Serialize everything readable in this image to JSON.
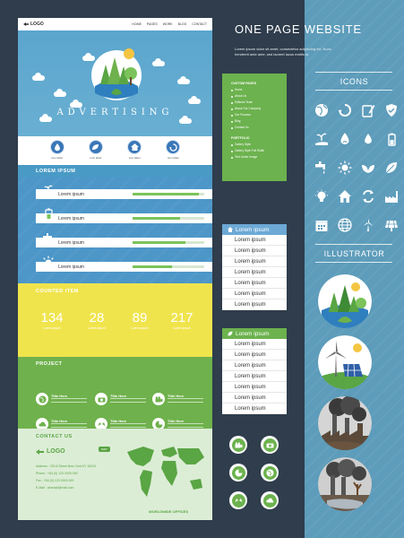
{
  "heading": "ONE PAGE WEBSITE",
  "description": [
    "Lorem ipsum dolor sit amet, consectetur adipiscing elit. Nunc",
    "hendrerit ante ante, sed laoreet lacus mattis et."
  ],
  "nav": {
    "logo": "LOGO",
    "links": [
      "HOME",
      "PAGES",
      "WORK",
      "BLOG",
      "CONTACT"
    ]
  },
  "hero": {
    "title": "ADVERTISING"
  },
  "features": [
    {
      "icon": "water-drop-icon",
      "label": "icon label"
    },
    {
      "icon": "leaf-icon",
      "label": "icon label"
    },
    {
      "icon": "house-icon",
      "label": "icon label"
    },
    {
      "icon": "recycle-icon",
      "label": "icon label"
    }
  ],
  "skills": {
    "title": "LOREM IPSUM",
    "items": [
      {
        "icon": "hand-plant-icon",
        "label": "Lorem ipsum",
        "level": 0.92
      },
      {
        "icon": "battery-icon",
        "label": "Lorem ipsum",
        "level": 0.66
      },
      {
        "icon": "faucet-icon",
        "label": "Lorem ipsum",
        "level": 0.74
      },
      {
        "icon": "sun-icon",
        "label": "Lorem ipsum",
        "level": 0.55
      }
    ]
  },
  "counted": {
    "title": "COUNTED ITEM",
    "items": [
      {
        "value": "134",
        "label": "Lorem ipsum"
      },
      {
        "value": "28",
        "label": "Lorem ipsum"
      },
      {
        "value": "89",
        "label": "Lorem ipsum"
      },
      {
        "value": "217",
        "label": "Lorem ipsum"
      }
    ]
  },
  "project": {
    "title": "PROJECT",
    "items": [
      {
        "icon": "globe-icon",
        "title": "Title Here"
      },
      {
        "icon": "camera-icon",
        "title": "Title Here"
      },
      {
        "icon": "film-camera-icon",
        "title": "Title Here"
      },
      {
        "icon": "cloud-icon",
        "title": "Title Here"
      },
      {
        "icon": "hands-icon",
        "title": "Title Here"
      },
      {
        "icon": "pie-chart-icon",
        "title": "Title Here"
      }
    ]
  },
  "contact": {
    "title": "CONTACT US",
    "logo": "LOGO",
    "address": "Address :  220 A Street New York NY 10010",
    "phone": "Phone  :  +84 (0) 123 0000 000",
    "fax": "Fax   :  +84 (0) 123 0000 000",
    "email": "E-Mail  :  abcmail@mail.com",
    "map_badge": "MAP",
    "map_caption": "WORLDWIDE OFFICES"
  },
  "custom_menu": {
    "heading": "CUSTOM PAGES",
    "items": [
      "Home",
      "About Us",
      "Editorial Team",
      "About Our Company",
      "Our Process",
      "Blog",
      "Contact Us"
    ],
    "heading2": "PORTFOLIO",
    "items2": [
      "Gallery Style",
      "Gallery Style Full Width",
      "Text Under Image"
    ]
  },
  "list1": {
    "head": "Lorem ipsum",
    "items": [
      "Lorem ipsum",
      "Lorem ipsum",
      "Lorem ipsum",
      "Lorem ipsum",
      "Lorem ipsum",
      "Lorem ipsum",
      "Lorem ipsum"
    ]
  },
  "list2": {
    "head": "Lorem ipsum",
    "items": [
      "Lorem ipsum",
      "Lorem ipsum",
      "Lorem ipsum",
      "Lorem ipsum",
      "Lorem ipsum",
      "Lorem ipsum",
      "Lorem ipsum"
    ]
  },
  "round_icons": [
    "film-camera-icon",
    "camera-icon",
    "pie-chart-icon",
    "globe-icon",
    "hands-icon",
    "cloud-icon"
  ],
  "icons_panel": {
    "title": "ICONS",
    "icons": [
      "globe-icon",
      "recycle-icon",
      "pencil-icon",
      "shield-icon",
      "hand-plant-icon",
      "water-drop-icon",
      "oil-drop-icon",
      "battery-icon",
      "faucet-icon",
      "sun-icon",
      "leaves-icon",
      "leaf-icon",
      "lightbulb-icon",
      "house-icon",
      "recycle-arrows-icon",
      "factory-icon",
      "calendar-icon",
      "world-icon",
      "wind-turbine-icon",
      "solar-panel-icon"
    ]
  },
  "illustrator": {
    "title": "ILLUSTRATOR",
    "items": [
      "green-landscape-illustration",
      "wind-solar-illustration",
      "factory-pollution-illustration",
      "dead-trees-factory-illustration"
    ]
  },
  "colors": {
    "background": "#2f3d4c",
    "panel": "#5d9cba",
    "blue": "#4c96c8",
    "green": "#6cb24e",
    "yellow": "#f0e44d"
  }
}
